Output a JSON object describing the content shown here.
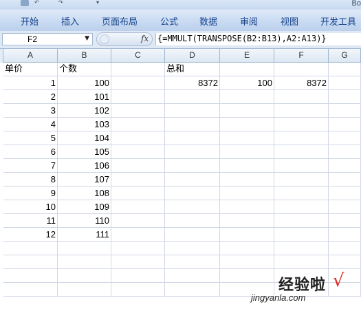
{
  "title": "Bo",
  "ribbon": {
    "tabs": [
      "开始",
      "插入",
      "页面布局",
      "公式",
      "数据",
      "审阅",
      "视图",
      "开发工具"
    ]
  },
  "formula_bar": {
    "name_box": "F2",
    "fx_label": "fx",
    "formula": "{=MMULT(TRANSPOSE(B2:B13),A2:A13)}"
  },
  "columns": [
    "A",
    "B",
    "C",
    "D",
    "E",
    "F",
    "G"
  ],
  "cells": {
    "A1": "单价",
    "B1": "个数",
    "D1": "总和",
    "A2": "1",
    "B2": "100",
    "D2": "8372",
    "E2": "100",
    "F2": "8372",
    "A3": "2",
    "B3": "101",
    "A4": "3",
    "B4": "102",
    "A5": "4",
    "B5": "103",
    "A6": "5",
    "B6": "104",
    "A7": "6",
    "B7": "105",
    "A8": "7",
    "B8": "106",
    "A9": "8",
    "B9": "107",
    "A10": "9",
    "B10": "108",
    "A11": "10",
    "B11": "109",
    "A12": "11",
    "B12": "110",
    "A13": "12",
    "B13": "111"
  },
  "watermark": {
    "logo": "经验啦",
    "check": "√",
    "url": "jingyanla.com"
  },
  "colors": {
    "ribbon_text": "#15428b",
    "grid_line": "#d0d7e5",
    "header_border": "#9eb6ce"
  }
}
